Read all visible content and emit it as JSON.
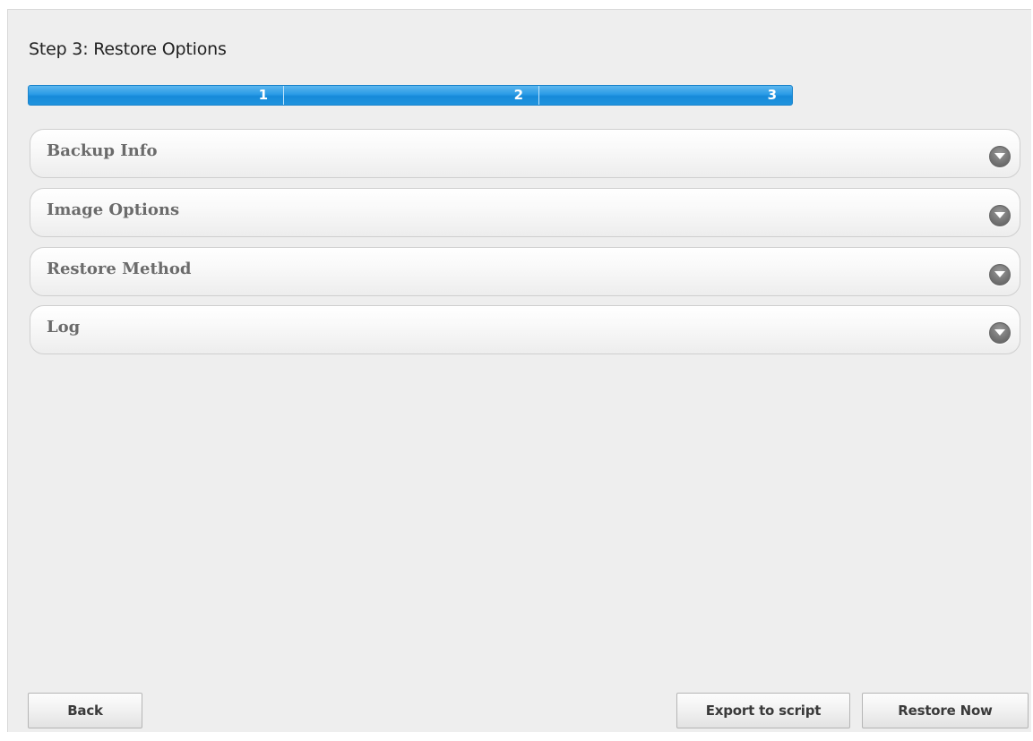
{
  "wizard": {
    "step_title": "Step 3: Restore Options",
    "progress": {
      "steps": [
        "1",
        "2",
        "3"
      ],
      "current_step": 3,
      "total_steps": 3,
      "bar_color": "#2a9be6"
    }
  },
  "sections": [
    {
      "label": "Backup Info",
      "icon": "expand-down-icon",
      "expanded": false
    },
    {
      "label": "Image Options",
      "icon": "expand-down-icon",
      "expanded": false
    },
    {
      "label": "Restore Method",
      "icon": "expand-down-icon",
      "expanded": false
    },
    {
      "label": "Log",
      "icon": "expand-down-icon",
      "expanded": false
    }
  ],
  "footer": {
    "back_label": "Back",
    "export_label": "Export to script",
    "restore_label": "Restore Now"
  }
}
